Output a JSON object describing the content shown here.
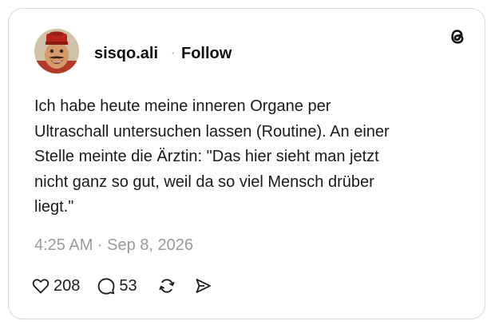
{
  "post": {
    "author": {
      "username": "sisqo.ali",
      "separator": "·",
      "follow_label": "Follow",
      "avatar_icon": "profile-photo"
    },
    "text": "Ich habe heute meine inneren Organe per\nUltraschall untersuchen lassen (Routine). An einer\nStelle meinte die Ärztin: \"Das hier sieht man jetzt\nnicht ganz so gut, weil da so viel Mensch drüber\nliegt.\"",
    "timestamp": "4:25 AM · Sep 8, 2026",
    "actions": {
      "like": {
        "icon": "heart-icon",
        "count": "208"
      },
      "reply": {
        "icon": "comment-icon",
        "count": "53"
      },
      "repost": {
        "icon": "repost-icon"
      },
      "share": {
        "icon": "share-icon"
      }
    },
    "brand": {
      "icon": "threads-logo-icon"
    }
  },
  "colors": {
    "text": "#1a1a1a",
    "muted": "#9a9a9a",
    "border": "#d9d9d9",
    "background": "#ffffff"
  }
}
